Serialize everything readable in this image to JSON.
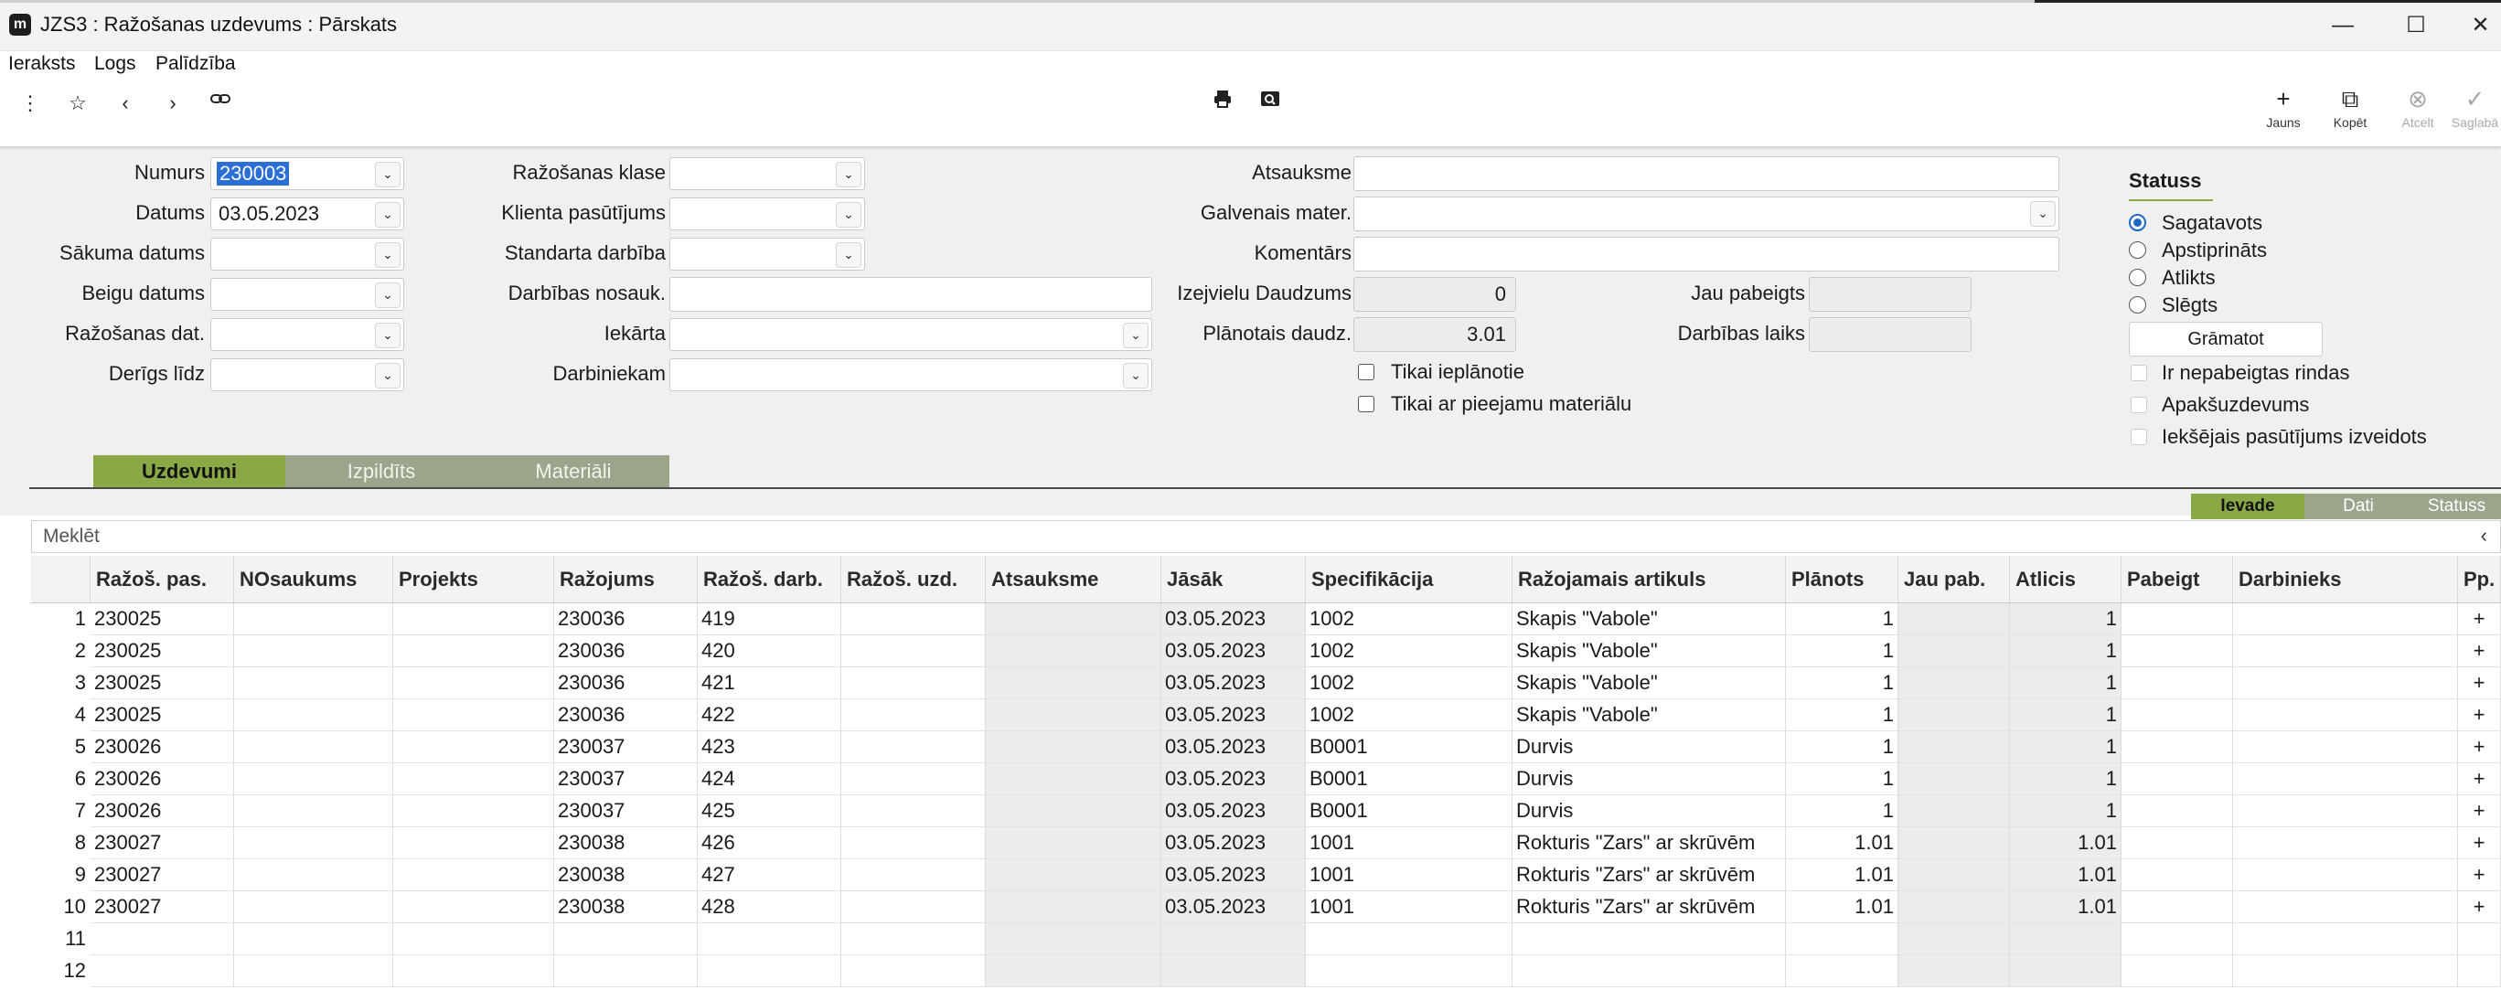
{
  "window": {
    "title": "JZS3 : Ražošanas uzdevums : Pārskats",
    "icon_letter": "m",
    "minimize": "—",
    "maximize": "☐",
    "close": "✕"
  },
  "menu": [
    "Ieraksts",
    "Logs",
    "Palīdzība"
  ],
  "toolbar": {
    "jauns": "Jauns",
    "kopet": "Kopēt",
    "atcelt": "Atcelt",
    "saglabat": "Saglabā"
  },
  "form": {
    "numurs_label": "Numurs",
    "numurs_value": "230003",
    "datums_label": "Datums",
    "datums_value": "03.05.2023",
    "sakuma_datums_label": "Sākuma datums",
    "sakuma_datums_value": "",
    "beigu_datums_label": "Beigu datums",
    "beigu_datums_value": "",
    "razosanas_dat_label": "Ražošanas dat.",
    "razosanas_dat_value": "",
    "derigs_lidz_label": "Derīgs līdz",
    "derigs_lidz_value": "",
    "razosanas_klase_label": "Ražošanas klase",
    "razosanas_klase_value": "",
    "klienta_pasutijums_label": "Klienta pasūtījums",
    "klienta_pasutijums_value": "",
    "standarta_darbiba_label": "Standarta darbība",
    "standarta_darbiba_value": "",
    "darbibas_nosauk_label": "Darbības nosauk.",
    "darbibas_nosauk_value": "",
    "iekarta_label": "Iekārta",
    "iekarta_value": "",
    "darbiniekam_label": "Darbiniekam",
    "darbiniekam_value": "",
    "atsauksme_label": "Atsauksme",
    "atsauksme_value": "",
    "galvenais_mater_label": "Galvenais mater.",
    "galvenais_mater_value": "",
    "komentars_label": "Komentārs",
    "komentars_value": "",
    "izejvielu_daudzums_label": "Izejvielu Daudzums",
    "izejvielu_daudzums_value": "0",
    "planotais_daudz_label": "Plānotais daudz.",
    "planotais_daudz_value": "3.01",
    "jau_pabeigts_label": "Jau pabeigts",
    "jau_pabeigts_value": "",
    "darbibas_laiks_label": "Darbības laiks",
    "darbibas_laiks_value": "",
    "tikai_ieplanotie": "Tikai ieplānotie",
    "tikai_ar_pieejamu": "Tikai ar pieejamu materiālu"
  },
  "status": {
    "title": "Statuss",
    "options": [
      "Sagatavots",
      "Apstiprināts",
      "Atlikts",
      "Slēgts"
    ],
    "selected": "Sagatavots",
    "gramatot": "Grāmatot",
    "flags": [
      "Ir nepabeigtas rindas",
      "Apakšuzdevums",
      "Iekšējais pasūtījums izveidots"
    ]
  },
  "tabs": [
    "Uzdevumi",
    "Izpildīts",
    "Materiāli"
  ],
  "right_tabs": [
    "Ievade",
    "Dati",
    "Statuss"
  ],
  "search_placeholder": "Meklēt",
  "grid": {
    "columns": [
      "Ražoš. pas.",
      "NOsaukums",
      "Projekts",
      "Ražojums",
      "Ražoš. darb.",
      "Ražoš. uzd.",
      "Atsauksme",
      "Jāsāk",
      "Specifikācija",
      "Ražojamais artikuls",
      "Plānots",
      "Jau pab.",
      "Atlicis",
      "Pabeigt",
      "Darbinieks",
      "Pp."
    ],
    "rows": [
      {
        "n": "1",
        "c": [
          "230025",
          "",
          "",
          "230036",
          "419",
          "",
          "",
          "03.05.2023",
          "1002",
          "Skapis \"Vabole\"",
          "1",
          "",
          "1",
          "",
          "",
          "+"
        ]
      },
      {
        "n": "2",
        "c": [
          "230025",
          "",
          "",
          "230036",
          "420",
          "",
          "",
          "03.05.2023",
          "1002",
          "Skapis \"Vabole\"",
          "1",
          "",
          "1",
          "",
          "",
          "+"
        ]
      },
      {
        "n": "3",
        "c": [
          "230025",
          "",
          "",
          "230036",
          "421",
          "",
          "",
          "03.05.2023",
          "1002",
          "Skapis \"Vabole\"",
          "1",
          "",
          "1",
          "",
          "",
          "+"
        ]
      },
      {
        "n": "4",
        "c": [
          "230025",
          "",
          "",
          "230036",
          "422",
          "",
          "",
          "03.05.2023",
          "1002",
          "Skapis \"Vabole\"",
          "1",
          "",
          "1",
          "",
          "",
          "+"
        ]
      },
      {
        "n": "5",
        "c": [
          "230026",
          "",
          "",
          "230037",
          "423",
          "",
          "",
          "03.05.2023",
          "B0001",
          "Durvis",
          "1",
          "",
          "1",
          "",
          "",
          "+"
        ]
      },
      {
        "n": "6",
        "c": [
          "230026",
          "",
          "",
          "230037",
          "424",
          "",
          "",
          "03.05.2023",
          "B0001",
          "Durvis",
          "1",
          "",
          "1",
          "",
          "",
          "+"
        ]
      },
      {
        "n": "7",
        "c": [
          "230026",
          "",
          "",
          "230037",
          "425",
          "",
          "",
          "03.05.2023",
          "B0001",
          "Durvis",
          "1",
          "",
          "1",
          "",
          "",
          "+"
        ]
      },
      {
        "n": "8",
        "c": [
          "230027",
          "",
          "",
          "230038",
          "426",
          "",
          "",
          "03.05.2023",
          "1001",
          "Rokturis \"Zars\" ar skrūvēm",
          "1.01",
          "",
          "1.01",
          "",
          "",
          "+"
        ]
      },
      {
        "n": "9",
        "c": [
          "230027",
          "",
          "",
          "230038",
          "427",
          "",
          "",
          "03.05.2023",
          "1001",
          "Rokturis \"Zars\" ar skrūvēm",
          "1.01",
          "",
          "1.01",
          "",
          "",
          "+"
        ]
      },
      {
        "n": "10",
        "c": [
          "230027",
          "",
          "",
          "230038",
          "428",
          "",
          "",
          "03.05.2023",
          "1001",
          "Rokturis \"Zars\" ar skrūvēm",
          "1.01",
          "",
          "1.01",
          "",
          "",
          "+"
        ]
      },
      {
        "n": "11",
        "c": [
          "",
          "",
          "",
          "",
          "",
          "",
          "",
          "",
          "",
          "",
          "",
          "",
          "",
          "",
          "",
          ""
        ]
      },
      {
        "n": "12",
        "c": [
          "",
          "",
          "",
          "",
          "",
          "",
          "",
          "",
          "",
          "",
          "",
          "",
          "",
          "",
          "",
          ""
        ]
      }
    ]
  }
}
